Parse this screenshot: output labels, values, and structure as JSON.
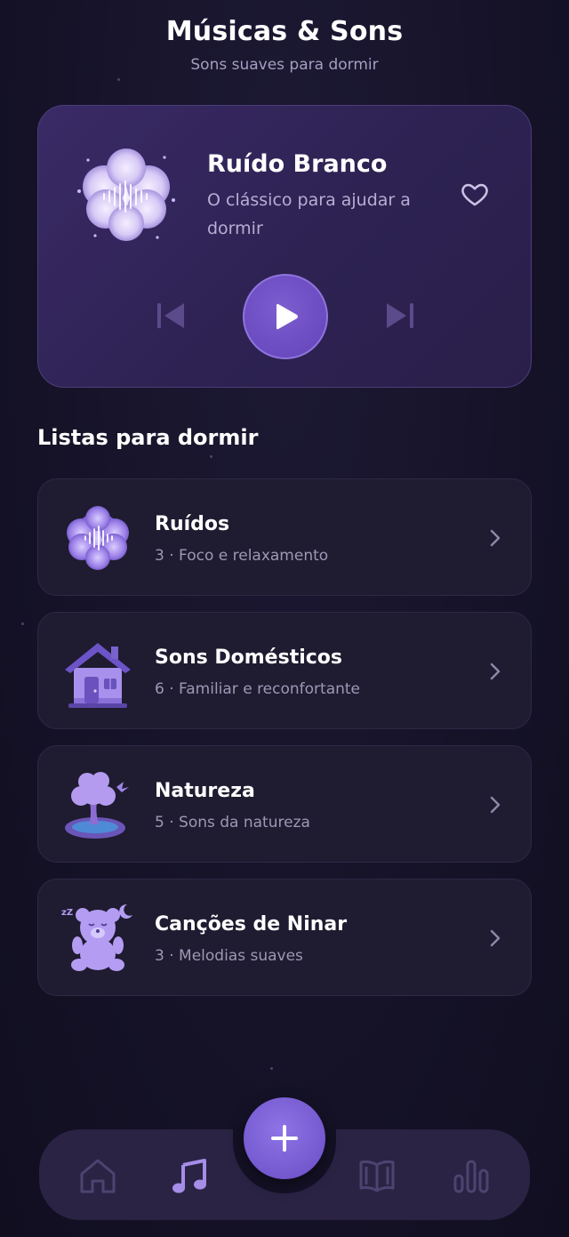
{
  "header": {
    "title": "Músicas & Sons",
    "subtitle": "Sons suaves para dormir"
  },
  "player": {
    "title": "Ruído Branco",
    "description": "O clássico para ajudar a dormir",
    "favorite": false
  },
  "playlists": {
    "title": "Listas para dormir",
    "items": [
      {
        "name": "Ruídos",
        "meta": "3 · Foco e relaxamento",
        "icon": "soundwave-cloud-icon"
      },
      {
        "name": "Sons Domésticos",
        "meta": "6 · Familiar e reconfortante",
        "icon": "house-icon"
      },
      {
        "name": "Natureza",
        "meta": "5 · Sons da natureza",
        "icon": "tree-pond-icon"
      },
      {
        "name": "Canções de Ninar",
        "meta": "3 · Melodias suaves",
        "icon": "teddy-bear-icon"
      }
    ]
  },
  "nav": {
    "items": [
      "home-icon",
      "music-note-icon",
      "add-icon",
      "book-icon",
      "stats-icon"
    ],
    "active": "music-note-icon"
  },
  "colors": {
    "accent": "#7458cf",
    "background": "#161329",
    "card": "#1f1b30",
    "muted_text": "#9e98b6"
  }
}
